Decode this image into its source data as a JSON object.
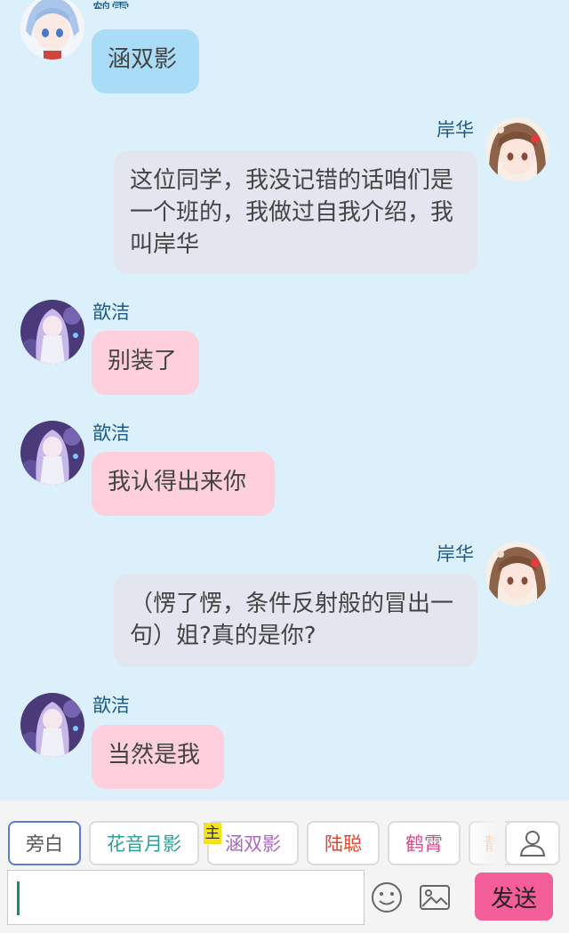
{
  "messages": [
    {
      "sender": "鹤霄",
      "text": "涵双影",
      "side": "left",
      "color": "blue",
      "avatar": "blue-hair-avatar"
    },
    {
      "sender": "岸华",
      "text": "这位同学，我没记错的话咱们是一个班的，我做过自我介绍，我叫岸华",
      "side": "right",
      "color": "grey",
      "avatar": "brown-hair-avatar"
    },
    {
      "sender": "歆洁",
      "text": "别装了",
      "side": "left",
      "color": "pink",
      "avatar": "purple-hair-avatar"
    },
    {
      "sender": "歆洁",
      "text": "我认得出来你",
      "side": "left",
      "color": "pink",
      "avatar": "purple-hair-avatar"
    },
    {
      "sender": "岸华",
      "text": "（愣了愣，条件反射般的冒出一句）姐?真的是你?",
      "side": "right",
      "color": "grey",
      "avatar": "brown-hair-avatar"
    },
    {
      "sender": "歆洁",
      "text": "当然是我",
      "side": "left",
      "color": "pink",
      "avatar": "purple-hair-avatar"
    }
  ],
  "characters": [
    {
      "label": "旁白",
      "color": "#555555",
      "selected": true
    },
    {
      "label": "花音月影",
      "color": "#2aa198"
    },
    {
      "label": "涵双影",
      "color": "#b064c8",
      "badge": "主"
    },
    {
      "label": "陆聪",
      "color": "#e0442b"
    },
    {
      "label": "鹤霄",
      "color": "#e0448a"
    },
    {
      "label": "静",
      "color": "#f08a3c"
    }
  ],
  "input": {
    "value": "",
    "placeholder": ""
  },
  "send_label": "发送",
  "icons": {
    "user": "user-icon",
    "emoji": "smiley-icon",
    "image": "image-icon"
  }
}
